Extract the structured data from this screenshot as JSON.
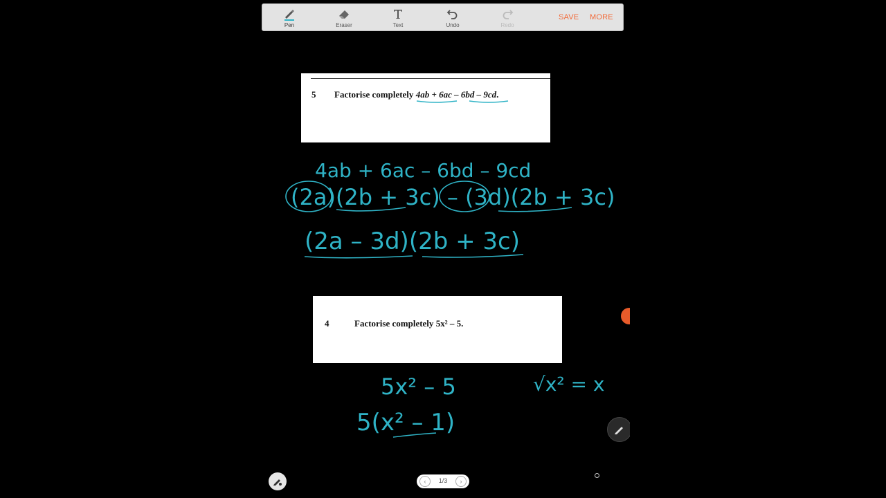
{
  "toolbar": {
    "tools": [
      {
        "label": "Pen",
        "icon": "pen-icon"
      },
      {
        "label": "Eraser",
        "icon": "eraser-icon"
      },
      {
        "label": "Text",
        "icon": "text-icon"
      },
      {
        "label": "Undo",
        "icon": "undo-icon"
      },
      {
        "label": "Redo",
        "icon": "redo-icon"
      }
    ],
    "save_label": "SAVE",
    "more_label": "MORE",
    "accent_color": "#f26b3a"
  },
  "questions": [
    {
      "number": "5",
      "prefix": "Factorise completely ",
      "expression": "4ab + 6ac – 6bd – 9cd",
      "suffix": "."
    },
    {
      "number": "4",
      "prefix": "Factorise completely ",
      "expression": "5x² – 5",
      "suffix": "."
    }
  ],
  "handwriting": {
    "ink_color": "#2fb3c6",
    "q5_line1": "4ab + 6ac – 6bd – 9cd",
    "q5_line2": "(2a)(2b + 3c) – (3d)(2b + 3c)",
    "q5_line3": "(2a – 3d)(2b + 3c)",
    "q4_line1": "5x² – 5",
    "q4_line2": "5(x² – 1)",
    "q4_side": "√x² = x"
  },
  "pager": {
    "page": "1/3"
  }
}
